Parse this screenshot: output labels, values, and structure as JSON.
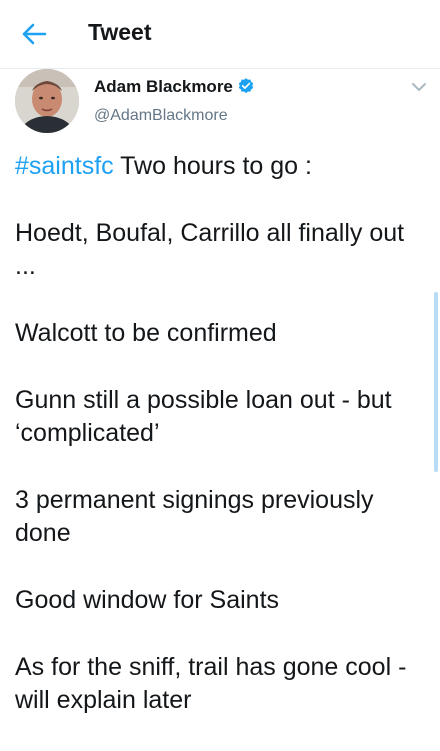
{
  "header": {
    "title": "Tweet",
    "back_icon": "arrow-left-icon",
    "accent_color": "#1da1f2"
  },
  "author": {
    "display_name": "Adam Blackmore",
    "handle": "@AdamBlackmore",
    "verified_icon": "verified-badge-icon"
  },
  "tweet": {
    "hashtag": "#saintsfc",
    "first_line_rest": " Two hours to go :",
    "paragraphs": [
      "Hoedt, Boufal, Carrillo all finally out ...",
      "Walcott to be confirmed",
      "Gunn still a possible loan out - but ‘complicated’",
      "3 permanent signings previously done",
      "Good window for Saints",
      "As for the sniff, trail has gone cool - will explain  later"
    ]
  }
}
